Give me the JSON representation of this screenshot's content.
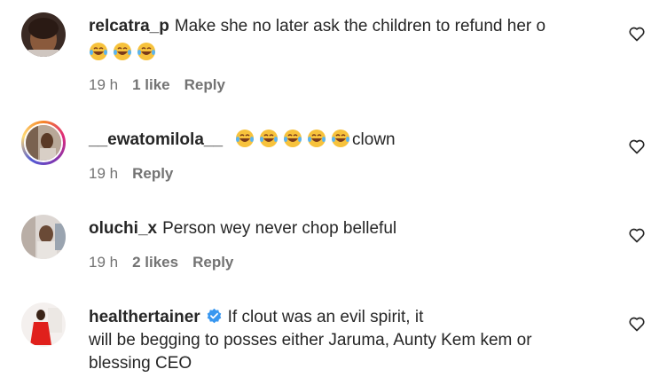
{
  "comments": [
    {
      "username": "relcatra_p",
      "text": "Make she no later ask the children to refund her o",
      "emojis": [
        "laughing-crying-emoji",
        "laughing-crying-emoji",
        "laughing-crying-emoji"
      ],
      "time": "19 h",
      "likes": "1 like",
      "reply": "Reply"
    },
    {
      "username": "__ewatomilola__",
      "emojis": [
        "laughing-crying-emoji",
        "laughing-crying-emoji",
        "laughing-crying-emoji",
        "laughing-crying-emoji",
        "laughing-crying-emoji"
      ],
      "text": "clown",
      "time": "19 h",
      "reply": "Reply"
    },
    {
      "username": "oluchi_x",
      "text": "Person wey never chop belleful",
      "time": "19 h",
      "likes": "2 likes",
      "reply": "Reply"
    },
    {
      "username": "healthertainer",
      "verified": true,
      "text_line1": "If clout was an evil spirit, it",
      "text_line2": "will be begging to posses either Jaruma, Aunty Kem kem or",
      "text_line3": "blessing CEO"
    }
  ],
  "colors": {
    "text": "#262626",
    "meta": "#737373",
    "verified": "#3897f0",
    "emoji_face": "#f7c23c"
  }
}
